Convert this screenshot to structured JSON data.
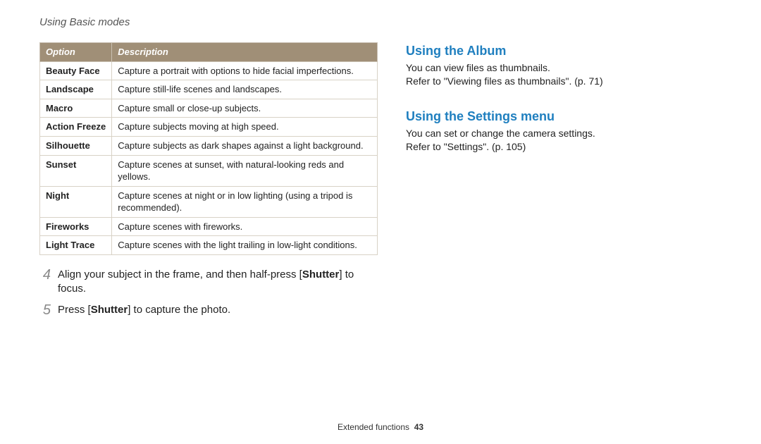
{
  "breadcrumb": "Using Basic modes",
  "table": {
    "headers": [
      "Option",
      "Description"
    ],
    "rows": [
      [
        "Beauty Face",
        "Capture a portrait with options to hide facial imperfections."
      ],
      [
        "Landscape",
        "Capture still-life scenes and landscapes."
      ],
      [
        "Macro",
        "Capture small or close-up subjects."
      ],
      [
        "Action Freeze",
        "Capture subjects moving at high speed."
      ],
      [
        "Silhouette",
        "Capture subjects as dark shapes against a light background."
      ],
      [
        "Sunset",
        "Capture scenes at sunset, with natural-looking reds and yellows."
      ],
      [
        "Night",
        "Capture scenes at night or in low lighting (using a tripod is recommended)."
      ],
      [
        "Fireworks",
        "Capture scenes with fireworks."
      ],
      [
        "Light Trace",
        "Capture scenes with the light trailing in low-light conditions."
      ]
    ]
  },
  "steps": [
    {
      "num": "4",
      "pre": "Align your subject in the frame, and then half-press [",
      "bold": "Shutter",
      "post": "] to focus."
    },
    {
      "num": "5",
      "pre": "Press [",
      "bold": "Shutter",
      "post": "] to capture the photo."
    }
  ],
  "sections": [
    {
      "heading": "Using the Album",
      "line1": "You can view files as thumbnails.",
      "line2": "Refer to \"Viewing files as thumbnails\". (p. 71)"
    },
    {
      "heading": "Using the Settings menu",
      "line1": "You can set or change the camera settings.",
      "line2": "Refer to \"Settings\". (p. 105)"
    }
  ],
  "footer": {
    "label": "Extended functions",
    "page": "43"
  }
}
